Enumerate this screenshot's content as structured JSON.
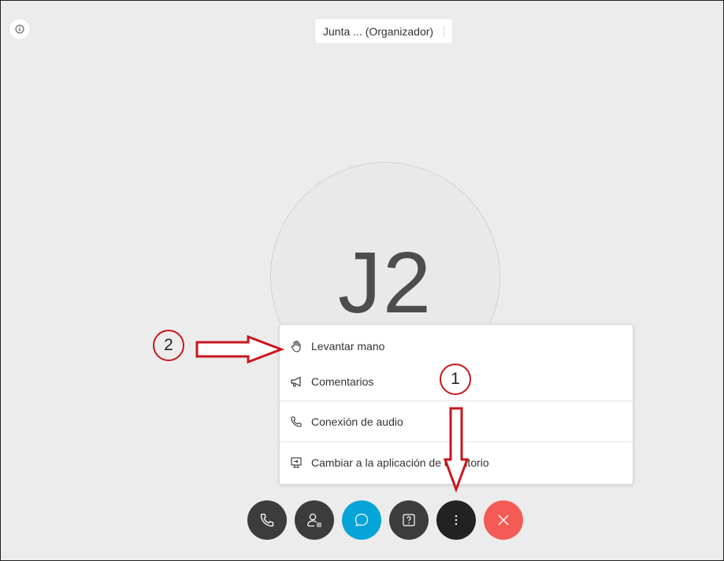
{
  "header": {
    "meeting_title": "Junta ... (Organizador)"
  },
  "participant": {
    "initials": "J2"
  },
  "more_menu": {
    "items": [
      {
        "label": "Levantar mano",
        "icon": "raise-hand-icon"
      },
      {
        "label": "Comentarios",
        "icon": "megaphone-icon"
      },
      {
        "label": "Conexión de audio",
        "icon": "phone-icon"
      },
      {
        "label": "Cambiar a la aplicación de escritorio",
        "icon": "desktop-app-icon"
      }
    ]
  },
  "controls": [
    {
      "name": "audio",
      "icon": "phone-icon",
      "color": "#3c3c3c"
    },
    {
      "name": "participants",
      "icon": "participants-icon",
      "color": "#3c3c3c"
    },
    {
      "name": "chat",
      "icon": "chat-icon",
      "color": "#07a4d8"
    },
    {
      "name": "qa",
      "icon": "question-icon",
      "color": "#3c3c3c"
    },
    {
      "name": "more",
      "icon": "more-vertical-icon",
      "color": "#222222"
    },
    {
      "name": "leave",
      "icon": "close-icon",
      "color": "#f25c54"
    }
  ],
  "annotations": {
    "step_1": "1",
    "step_2": "2",
    "color": "#c8161b"
  }
}
